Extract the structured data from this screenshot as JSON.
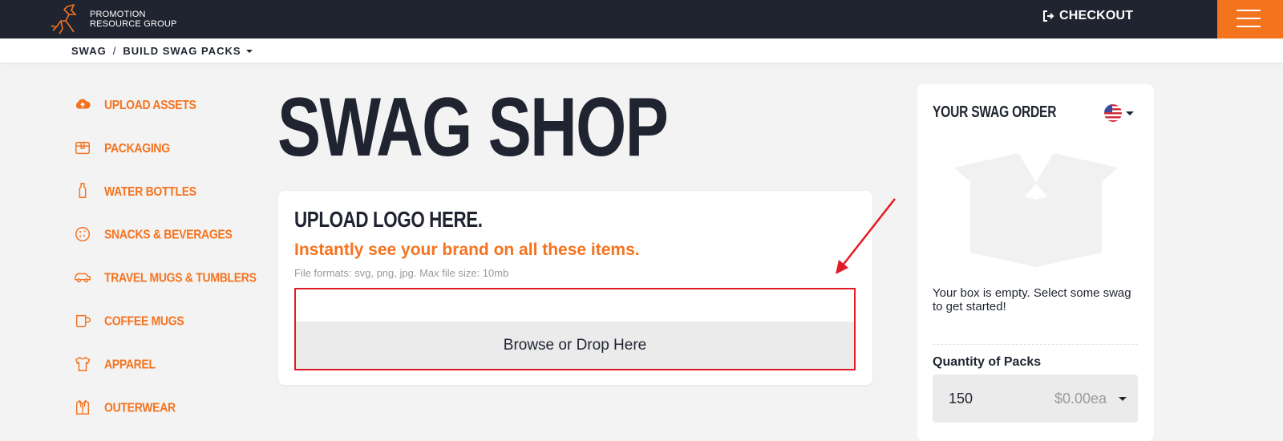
{
  "header": {
    "logo_line1": "PROMOTION",
    "logo_line2": "RESOURCE GROUP",
    "checkout_label": "CHECKOUT",
    "checkout_icon": "sign-out-icon",
    "menu_icon": "hamburger-icon"
  },
  "breadcrumb": {
    "items": [
      "SWAG",
      "BUILD SWAG PACKS"
    ],
    "separator": "/"
  },
  "sidebar": {
    "items": [
      {
        "label": "UPLOAD ASSETS",
        "icon": "cloud-upload-icon"
      },
      {
        "label": "PACKAGING",
        "icon": "box-icon"
      },
      {
        "label": "WATER BOTTLES",
        "icon": "bottle-icon"
      },
      {
        "label": "SNACKS & BEVERAGES",
        "icon": "cookie-icon"
      },
      {
        "label": "TRAVEL MUGS & TUMBLERS",
        "icon": "car-icon"
      },
      {
        "label": "COFFEE MUGS",
        "icon": "mug-icon"
      },
      {
        "label": "APPAREL",
        "icon": "shirt-icon"
      },
      {
        "label": "OUTERWEAR",
        "icon": "jacket-icon"
      }
    ]
  },
  "main": {
    "title": "SWAG SHOP",
    "upload": {
      "title": "UPLOAD LOGO HERE.",
      "subtitle": "Instantly see your brand on all these items.",
      "hint": "File formats: svg, png, jpg. Max file size: 10mb",
      "browse_label": "Browse or Drop Here"
    }
  },
  "order": {
    "title": "YOUR SWAG ORDER",
    "flag_icon": "us-flag-icon",
    "empty_message": "Your box is empty. Select some swag to get started!",
    "quantity_label": "Quantity of Packs",
    "quantity_value": "150",
    "price": "$0.00ea"
  },
  "colors": {
    "brand_orange": "#f4731f",
    "dark_navy": "#1f2430",
    "annotation_red": "#e01b24"
  }
}
